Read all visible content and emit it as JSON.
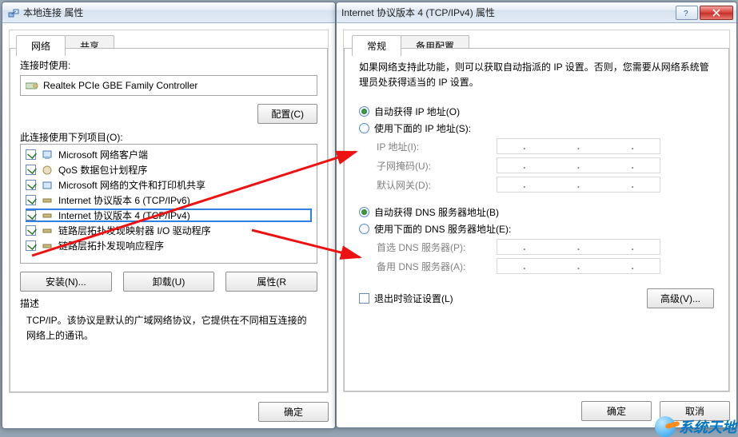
{
  "left_window": {
    "title": "本地连接 属性",
    "tabs": [
      {
        "label": "网络",
        "active": true
      },
      {
        "label": "共享",
        "active": false
      }
    ],
    "connect_using_label": "连接时使用:",
    "adapter_name": "Realtek PCIe GBE Family Controller",
    "configure_btn": "配置(C)",
    "items_label": "此连接使用下列项目(O):",
    "items": [
      {
        "checked": true,
        "icon": "client-icon",
        "label": "Microsoft 网络客户端"
      },
      {
        "checked": true,
        "icon": "qos-icon",
        "label": "QoS 数据包计划程序"
      },
      {
        "checked": true,
        "icon": "share-icon",
        "label": "Microsoft 网络的文件和打印机共享"
      },
      {
        "checked": true,
        "icon": "protocol-icon",
        "label": "Internet 协议版本 6 (TCP/IPv6)"
      },
      {
        "checked": true,
        "icon": "protocol-icon",
        "label": "Internet 协议版本 4 (TCP/IPv4)",
        "highlight": true
      },
      {
        "checked": true,
        "icon": "driver-icon",
        "label": "链路层拓扑发现映射器 I/O 驱动程序"
      },
      {
        "checked": true,
        "icon": "driver-icon",
        "label": "链路层拓扑发现响应程序"
      }
    ],
    "install_btn": "安装(N)...",
    "uninstall_btn": "卸载(U)",
    "properties_btn": "属性(R",
    "description_label": "描述",
    "description_text": "TCP/IP。该协议是默认的广域网络协议，它提供在不同相互连接的网络上的通讯。",
    "ok_btn": "确定"
  },
  "right_window": {
    "title": "Internet 协议版本 4 (TCP/IPv4) 属性",
    "tabs": [
      {
        "label": "常规",
        "active": true
      },
      {
        "label": "备用配置",
        "active": false
      }
    ],
    "intro_text": "如果网络支持此功能，则可以获取自动指派的 IP 设置。否则，您需要从网络系统管理员处获得适当的 IP 设置。",
    "ip_group": {
      "auto_label": "自动获得 IP 地址(O)",
      "auto_checked": true,
      "manual_label": "使用下面的 IP 地址(S):",
      "manual_checked": false,
      "fields": [
        {
          "label": "IP 地址(I):"
        },
        {
          "label": "子网掩码(U):"
        },
        {
          "label": "默认网关(D):"
        }
      ]
    },
    "dns_group": {
      "auto_label": "自动获得 DNS 服务器地址(B)",
      "auto_checked": true,
      "manual_label": "使用下面的 DNS 服务器地址(E):",
      "manual_checked": false,
      "fields": [
        {
          "label": "首选 DNS 服务器(P):"
        },
        {
          "label": "备用 DNS 服务器(A):"
        }
      ]
    },
    "validate_label": "退出时验证设置(L)",
    "validate_checked": false,
    "advanced_btn": "高级(V)...",
    "ok_btn": "确定",
    "cancel_btn": "取消"
  },
  "watermark": "系统天地"
}
